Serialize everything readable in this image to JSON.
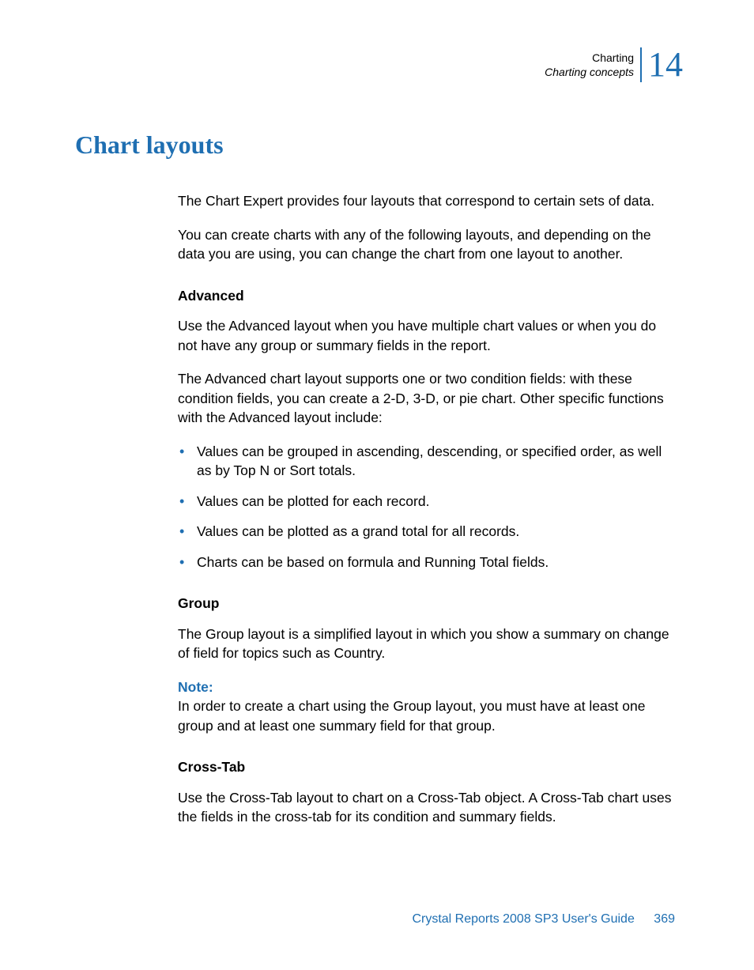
{
  "header": {
    "chapter": "Charting",
    "section": "Charting concepts",
    "number": "14"
  },
  "title": "Chart layouts",
  "intro1": "The Chart Expert provides four layouts that correspond to certain sets of data.",
  "intro2": "You can create charts with any of the following layouts, and depending on the data you are using, you can change the chart from one layout to another.",
  "advanced": {
    "heading": "Advanced",
    "p1": "Use the Advanced layout when you have multiple chart values or when you do not have any group or summary fields in the report.",
    "p2": "The Advanced chart layout supports one or two condition fields: with these condition fields, you can create a 2-D, 3-D, or pie chart. Other specific functions with the Advanced layout include:",
    "bullets": [
      "Values can be grouped in ascending, descending, or specified order, as well as by Top N or Sort totals.",
      "Values can be plotted for each record.",
      "Values can be plotted as a grand total for all records.",
      "Charts can be based on formula and Running Total fields."
    ]
  },
  "group": {
    "heading": "Group",
    "p1": "The Group layout is a simplified layout in which you show a summary on change of field for topics such as Country.",
    "note_label": "Note:",
    "note_body": "In order to create a chart using the Group layout, you must have at least one group and at least one summary field for that group."
  },
  "crosstab": {
    "heading": "Cross-Tab",
    "p1": "Use the Cross-Tab layout to chart on a Cross-Tab object. A Cross-Tab chart uses the fields in the cross-tab for its condition and summary fields."
  },
  "footer": {
    "guide": "Crystal Reports 2008 SP3 User's Guide",
    "page": "369"
  }
}
